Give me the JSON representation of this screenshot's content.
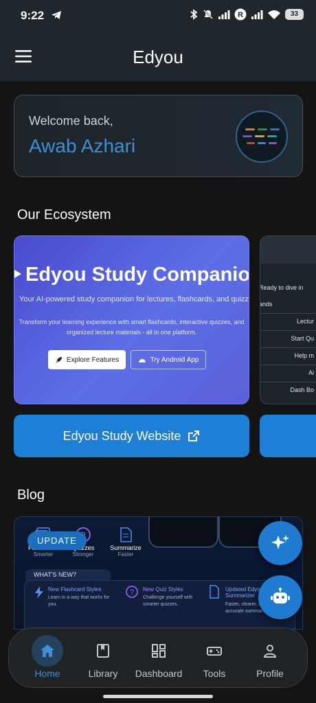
{
  "status_bar": {
    "time": "9:22",
    "battery": "33",
    "icons": [
      "telegram-icon",
      "bluetooth-icon",
      "mute-icon",
      "signal-icon",
      "r-badge-icon",
      "signal-icon",
      "wifi-icon",
      "battery-icon"
    ]
  },
  "app_bar": {
    "title": "Edyou",
    "menu_icon": "menu-icon"
  },
  "welcome": {
    "label": "Welcome back,",
    "name": "Awab Azhari",
    "accent_color": "#3d8fd8"
  },
  "ecosystem": {
    "title": "Our Ecosystem",
    "card": {
      "title": "Edyou Study Companion",
      "subtitle": "Your AI-powered study companion for lectures, flashcards, and quizzes",
      "description": "Transform your learning experience with smart flashcards, interactive quizzes, and organized lecture materials - all in one platform.",
      "primary_button": "Explore Features",
      "secondary_button": "Try Android App"
    },
    "card2": {
      "intro": "Ready to dive in",
      "subintro": "ands",
      "items": [
        "Lectur",
        "Start Qu",
        "Help m",
        "Ai",
        "Dash Bo"
      ]
    },
    "website_button": "Edyou Study Website"
  },
  "blog": {
    "title": "Blog",
    "badge": "UPDATE",
    "features": [
      {
        "label": "Flashcards",
        "sub": "Smarter"
      },
      {
        "label": "Quizzes",
        "sub": "Stronger"
      },
      {
        "label": "Summarize",
        "sub": "Faster"
      }
    ],
    "whats_new": "WHAT'S NEW?",
    "items": [
      {
        "title": "New Flashcard Styles",
        "text": "Learn in a way that works for you."
      },
      {
        "title": "New Quiz Styles",
        "text": "Challenge yourself with smarter quizzes."
      },
      {
        "title": "Updated Edyou Summarizer",
        "text": "Faster, clearer, and more accurate summaries."
      }
    ]
  },
  "fabs": [
    {
      "name": "ai-sparkle-icon"
    },
    {
      "name": "chatbot-icon"
    }
  ],
  "bottom_nav": {
    "items": [
      {
        "label": "Home",
        "icon": "home-icon",
        "active": true
      },
      {
        "label": "Library",
        "icon": "book-icon",
        "active": false
      },
      {
        "label": "Dashboard",
        "icon": "dashboard-icon",
        "active": false
      },
      {
        "label": "Tools",
        "icon": "tools-icon",
        "active": false
      },
      {
        "label": "Profile",
        "icon": "person-icon",
        "active": false
      }
    ]
  }
}
